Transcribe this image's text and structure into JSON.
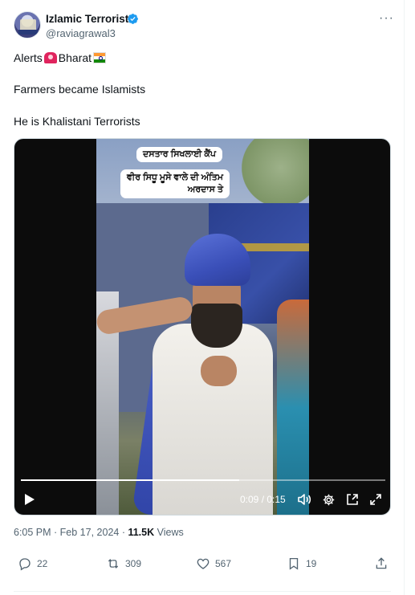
{
  "author": {
    "display_name": "Izlamic Terrorist",
    "handle": "@raviagrawal3",
    "verified": true
  },
  "tweet": {
    "line1_a": "Alerts",
    "line1_b": "Bharat",
    "line2": "Farmers became Islamists",
    "line3": "He is Khalistani Terrorists",
    "emojis": [
      "siren-icon",
      "india-flag-icon"
    ]
  },
  "video": {
    "caption_line1": "ਦਸਤਾਰ ਸਿਖਲਾਈ ਕੈਂਪ",
    "caption_line2": "ਵੀਰ ਸਿਧੂ ਮੂਸੇ ਵਾਲੇ ਦੀ ਅੰਤਿਮ",
    "caption_line3": "ਅਰਦਾਸ ਤੇ",
    "time_display": "0:09 / 0:15",
    "progress_percent": 60
  },
  "meta": {
    "time": "6:05 PM",
    "separator": " · ",
    "date": "Feb 17, 2024",
    "views_count": "11.5K",
    "views_label": " Views"
  },
  "actions": {
    "replies": "22",
    "reposts": "309",
    "likes": "567",
    "bookmarks": "19"
  },
  "colors": {
    "text_primary": "#0f1419",
    "text_secondary": "#536471",
    "verified_blue": "#1d9bf0",
    "border": "#eff3f4"
  }
}
